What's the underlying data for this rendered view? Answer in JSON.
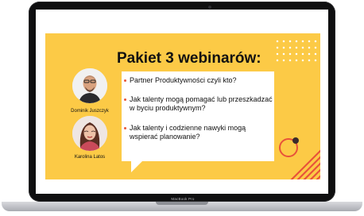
{
  "device": {
    "brand_label": "MacBook Pro"
  },
  "slide": {
    "title": "Pakiet 3 webinarów:",
    "speakers": [
      {
        "name": "Dominik Juszczyk"
      },
      {
        "name": "Karolina Latos"
      }
    ],
    "topics": [
      "Partner Produktywności czyli kto?",
      "Jak talenty mogą pomagać lub przeszkadzać w byciu produktywnym?",
      "Jak talenty i codzienne nawyki mogą wspierać planowanie?"
    ],
    "colors": {
      "background": "#fcca46",
      "accent": "#e85a3a",
      "bubble": "#ffffff",
      "text": "#111111"
    }
  }
}
